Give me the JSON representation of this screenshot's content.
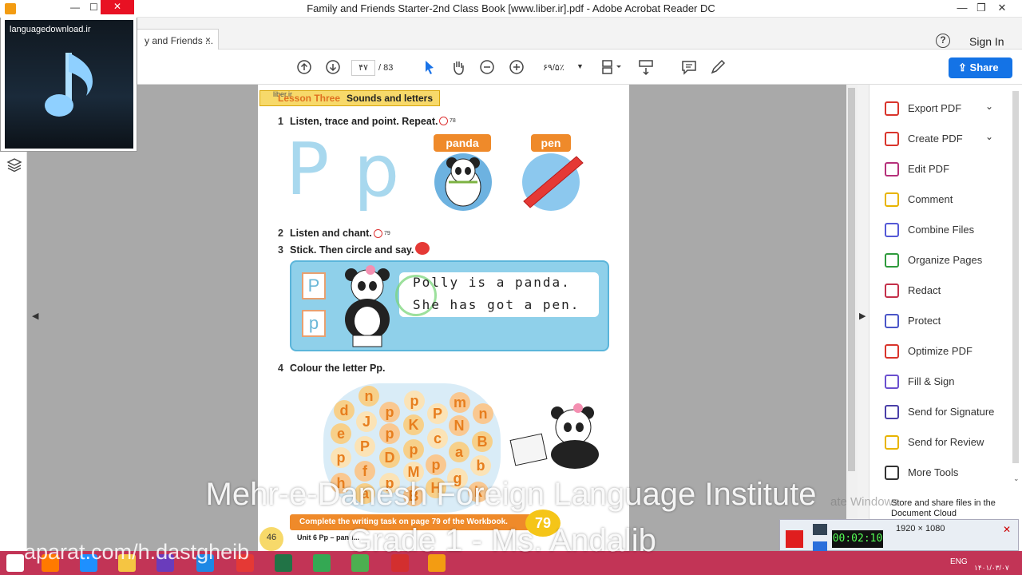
{
  "window": {
    "title": "Family and Friends Starter-2nd Class Book [www.liber.ir].pdf - Adobe Acrobat Reader DC",
    "min": "—",
    "max": "❐",
    "close": "✕"
  },
  "tab": {
    "label": "y and Friends ...",
    "close": "×"
  },
  "header": {
    "help": "?",
    "signin": "Sign In"
  },
  "toolbar": {
    "page_current": "۴۷",
    "page_total": "/ 83",
    "zoom": "۶۹/۵٪",
    "share": "Share"
  },
  "right_panel": {
    "items": [
      {
        "label": "Export PDF",
        "icon": "export-pdf-icon",
        "color": "#d9342b",
        "chevron": "⌄"
      },
      {
        "label": "Create PDF",
        "icon": "create-pdf-icon",
        "color": "#d9342b",
        "chevron": "⌄"
      },
      {
        "label": "Edit PDF",
        "icon": "edit-pdf-icon",
        "color": "#b5307a"
      },
      {
        "label": "Comment",
        "icon": "comment-icon",
        "color": "#e8b400"
      },
      {
        "label": "Combine Files",
        "icon": "combine-files-icon",
        "color": "#5458d6"
      },
      {
        "label": "Organize Pages",
        "icon": "organize-pages-icon",
        "color": "#2e9a3c"
      },
      {
        "label": "Redact",
        "icon": "redact-icon",
        "color": "#c4304a"
      },
      {
        "label": "Protect",
        "icon": "protect-icon",
        "color": "#4a55c8"
      },
      {
        "label": "Optimize PDF",
        "icon": "optimize-pdf-icon",
        "color": "#d9342b"
      },
      {
        "label": "Fill & Sign",
        "icon": "fill-sign-icon",
        "color": "#6a4fcf"
      },
      {
        "label": "Send for Signature",
        "icon": "send-signature-icon",
        "color": "#4a3fa8"
      },
      {
        "label": "Send for Review",
        "icon": "send-review-icon",
        "color": "#e8b400"
      },
      {
        "label": "More Tools",
        "icon": "more-tools-icon",
        "color": "#333333"
      }
    ],
    "footer": "Store and share files in the Document Cloud"
  },
  "mini_player": {
    "url": "languagedownload.ir"
  },
  "pdf_page": {
    "liber": "liber.ir",
    "lesson_a": "Lesson Three",
    "lesson_b": "Sounds and letters",
    "ex1_num": "1",
    "ex1": "Listen, trace and point. Repeat.",
    "ex1_track": "78",
    "tag_panda": "panda",
    "tag_pen": "pen",
    "ex2_num": "2",
    "ex2": "Listen and chant.",
    "ex2_track": "79",
    "ex3_num": "3",
    "ex3": "Stick. Then circle and say.",
    "chant_line1": "Polly is a panda.",
    "chant_line2": "She has got a pen.",
    "box_upper": "P",
    "box_lower": "p",
    "big_upper": "P",
    "big_lower": "p",
    "ex4_num": "4",
    "ex4": "Colour the letter Pp.",
    "workbook": "Complete the writing task on page 79 of the Workbook.",
    "wb_page": "79",
    "page_number": "46",
    "unit": "Unit 6   Pp – pand..."
  },
  "bubbles": [
    "n",
    "p",
    "m",
    "d",
    "J",
    "p",
    "K",
    "P",
    "n",
    "e",
    "P",
    "p",
    "p",
    "c",
    "N",
    "B",
    "p",
    "f",
    "D",
    "M",
    "p",
    "a",
    "b",
    "h",
    "a",
    "p",
    "B",
    "H",
    "g",
    "k"
  ],
  "overlay": {
    "line1": "Mehr-e-Danesh Foreign Language Institute",
    "line2": "Grade 1 - Ms. Andalib",
    "line3": "aparat.com/h.dastgheib",
    "watermark": "ate Windows"
  },
  "recorder": {
    "resolution": "1920 × 1080",
    "timer": "00:02:10"
  },
  "taskbar": {
    "lang": "ENG",
    "date": "۱۴۰۱/۰۳/۰۷"
  }
}
